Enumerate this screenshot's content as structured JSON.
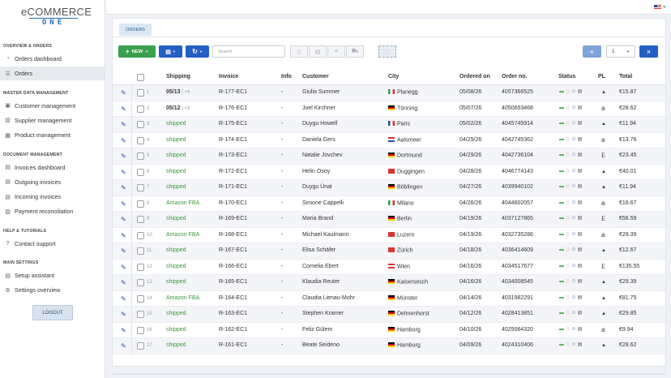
{
  "logo": {
    "top": "eCOMMERCE",
    "bottom": "ONE"
  },
  "sidebar": {
    "sections": [
      {
        "title": "OVERVIEW & ORDERS",
        "items": [
          {
            "label": "Orders dashboard",
            "icon": "gauge-icon"
          },
          {
            "label": "Orders",
            "icon": "list-icon",
            "active": true
          }
        ]
      },
      {
        "title": "MASTER DATA MANAGEMENT",
        "items": [
          {
            "label": "Customer management",
            "icon": "customer-icon"
          },
          {
            "label": "Supplier management",
            "icon": "truck-icon"
          },
          {
            "label": "Product management",
            "icon": "product-icon"
          }
        ]
      },
      {
        "title": "DOCUMENT MANAGEMENT",
        "items": [
          {
            "label": "Invoices dashboard",
            "icon": "document-icon"
          },
          {
            "label": "Outgoing invoices",
            "icon": "document-icon"
          },
          {
            "label": "Incoming invoices",
            "icon": "document-icon"
          },
          {
            "label": "Payment reconciliation",
            "icon": "payment-icon"
          }
        ]
      },
      {
        "title": "HELP & TUTORIALS",
        "items": [
          {
            "label": "Contact support",
            "icon": "help-icon"
          }
        ]
      },
      {
        "title": "MAIN SETTINGS",
        "items": [
          {
            "label": "Setup assistant",
            "icon": "wizard-icon"
          },
          {
            "label": "Settings overview",
            "icon": "gears-icon"
          }
        ]
      }
    ],
    "logout": "LOGOUT"
  },
  "tab": "ORDERS",
  "toolbar": {
    "new_label": "NEW",
    "search_placeholder": "Search",
    "page": "1"
  },
  "table": {
    "headers": {
      "shipping": "Shipping",
      "invoice": "Invoice",
      "info": "Info",
      "customer": "Customer",
      "city": "City",
      "ordered_on": "Ordered on",
      "order_no": "Order no.",
      "status": "Status",
      "pl": "PL",
      "total": "Total"
    },
    "rows": [
      {
        "n": "1",
        "shipping": "05/13",
        "ship_extra": "+4",
        "ship_type": "date",
        "invoice": "R-177-EC1",
        "info": "-",
        "customer": "Giulia Summer",
        "city": "Planegg",
        "flag": "it",
        "date": "05/08/26",
        "order": "4057366525",
        "pl": "bag",
        "total": "€15.87"
      },
      {
        "n": "2",
        "shipping": "05/12",
        "ship_extra": "+3",
        "ship_type": "date",
        "invoice": "R-176-EC1",
        "info": "-",
        "customer": "Joel Kirchner",
        "city": "Tönning",
        "flag": "de",
        "date": "05/07/26",
        "order": "4050653468",
        "pl": "amazon",
        "total": "€28.62"
      },
      {
        "n": "3",
        "shipping": "shipped",
        "ship_type": "green",
        "invoice": "R-175-EC1",
        "info": "-",
        "customer": "Duygu Howell",
        "city": "Paris",
        "flag": "fr",
        "date": "05/02/26",
        "order": "4045745914",
        "pl": "bag",
        "total": "€11.94"
      },
      {
        "n": "4",
        "shipping": "shipped",
        "ship_type": "green",
        "invoice": "R-174-EC1",
        "info": "-",
        "customer": "Daniela Gers",
        "city": "Aalsmeer",
        "flag": "nl",
        "date": "04/29/26",
        "order": "4042745362",
        "pl": "amazon",
        "total": "€13.76"
      },
      {
        "n": "5",
        "shipping": "shipped",
        "ship_type": "green",
        "invoice": "R-173-EC1",
        "info": "-",
        "customer": "Natalie Jovchev",
        "city": "Dortmund",
        "flag": "de",
        "date": "04/29/26",
        "order": "4042736104",
        "pl": "ebay",
        "total": "€23.45"
      },
      {
        "n": "6",
        "shipping": "shipped",
        "ship_type": "green",
        "invoice": "R-172-EC1",
        "info": "-",
        "customer": "Helin Osoy",
        "city": "Duggingen",
        "flag": "ch",
        "date": "04/28/26",
        "order": "4046774143",
        "pl": "bag",
        "total": "€40.01"
      },
      {
        "n": "7",
        "shipping": "shipped",
        "ship_type": "green",
        "invoice": "R-171-EC1",
        "info": "-",
        "customer": "Duygu Ünal",
        "city": "Böblingen",
        "flag": "de",
        "date": "04/27/26",
        "order": "4039940102",
        "pl": "bag",
        "total": "€11.94"
      },
      {
        "n": "8",
        "shipping": "Amazon FBA",
        "ship_type": "green",
        "invoice": "R-170-EC1",
        "info": "-",
        "customer": "Simone Cappelli",
        "city": "Milano",
        "flag": "it",
        "date": "04/26/26",
        "order": "4044602057",
        "pl": "amazon",
        "total": "€16.67"
      },
      {
        "n": "9",
        "shipping": "shipped",
        "ship_type": "green",
        "invoice": "R-169-EC1",
        "info": "-",
        "customer": "Maria Brand",
        "city": "Berlin",
        "flag": "de",
        "date": "04/19/26",
        "order": "4037127865",
        "pl": "ebay",
        "total": "€56.59"
      },
      {
        "n": "10",
        "shipping": "Amazon FBA",
        "ship_type": "green",
        "invoice": "R-168-EC1",
        "info": "-",
        "customer": "Michael Kaulmann",
        "city": "Luzern",
        "flag": "ch",
        "date": "04/19/26",
        "order": "4032735286",
        "pl": "amazon",
        "total": "€29.39"
      },
      {
        "n": "11",
        "shipping": "shipped",
        "ship_type": "green",
        "invoice": "R-167-EC1",
        "info": "-",
        "customer": "Elisa Schäfer",
        "city": "Zürich",
        "flag": "ch",
        "date": "04/18/26",
        "order": "4036414609",
        "pl": "bag",
        "total": "€12.67"
      },
      {
        "n": "12",
        "shipping": "shipped",
        "ship_type": "green",
        "invoice": "R-166-EC1",
        "info": "-",
        "customer": "Cornelia Ebert",
        "city": "Wien",
        "flag": "at",
        "date": "04/16/26",
        "order": "4034517677",
        "pl": "ebay",
        "total": "€135.55"
      },
      {
        "n": "13",
        "shipping": "shipped",
        "ship_type": "green",
        "invoice": "R-165-EC1",
        "info": "-",
        "customer": "Klaudia Reuter",
        "city": "Kaisersesch",
        "flag": "de",
        "date": "04/16/26",
        "order": "4034008545",
        "pl": "bag",
        "total": "€29.39"
      },
      {
        "n": "14",
        "shipping": "Amazon FBA",
        "ship_type": "green",
        "invoice": "R-164-EC1",
        "info": "-",
        "customer": "Claudia Lienau-Mohr",
        "city": "Münster",
        "flag": "de",
        "date": "04/14/26",
        "order": "4031982291",
        "pl": "bag",
        "total": "€81.75"
      },
      {
        "n": "15",
        "shipping": "shipped",
        "ship_type": "green",
        "invoice": "R-163-EC1",
        "info": "-",
        "customer": "Stephen Kramer",
        "city": "Delmenhorst",
        "flag": "de",
        "date": "04/12/26",
        "order": "4028413851",
        "pl": "bag",
        "total": "€29.85"
      },
      {
        "n": "16",
        "shipping": "shipped",
        "ship_type": "green",
        "invoice": "R-162-EC1",
        "info": "-",
        "customer": "Feliz Gülem",
        "city": "Hamburg",
        "flag": "de",
        "date": "04/10/26",
        "order": "4025064320",
        "pl": "amazon",
        "total": "€9.94"
      },
      {
        "n": "17",
        "shipping": "shipped",
        "ship_type": "green",
        "invoice": "R-161-EC1",
        "info": "-",
        "customer": "Beate Seideno",
        "city": "Hamburg",
        "flag": "de",
        "date": "04/09/26",
        "order": "4024310406",
        "pl": "bag",
        "total": "€28.62"
      }
    ]
  },
  "colors": {
    "accent": "#2360c4",
    "green": "#3aa050",
    "shipped": "#3a9a3a"
  }
}
